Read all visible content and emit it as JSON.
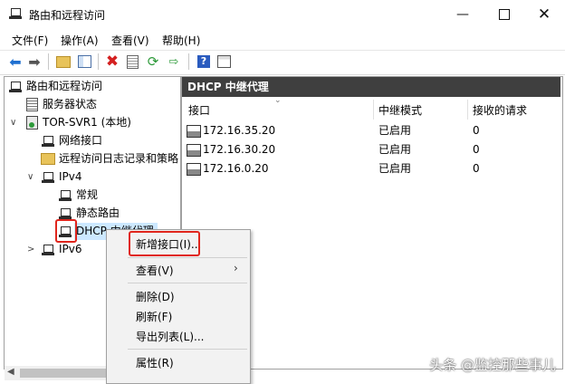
{
  "window": {
    "title": "路由和远程访问"
  },
  "menu": [
    "文件(F)",
    "操作(A)",
    "查看(V)",
    "帮助(H)"
  ],
  "tree": {
    "root": "路由和远程访问",
    "server_status": "服务器状态",
    "server": "TOR-SVR1 (本地)",
    "network_interfaces": "网络接口",
    "remote_logging": "远程访问日志记录和策略",
    "ipv4": "IPv4",
    "general": "常规",
    "static_routes": "静态路由",
    "dhcp_relay": "DHCP 中继代理",
    "ipv6": "IPv6"
  },
  "list": {
    "title": "DHCP 中继代理",
    "columns": [
      "接口",
      "中继模式",
      "接收的请求"
    ],
    "rows": [
      {
        "interface": "172.16.35.20",
        "mode": "已启用",
        "requests": "0"
      },
      {
        "interface": "172.16.30.20",
        "mode": "已启用",
        "requests": "0"
      },
      {
        "interface": "172.16.0.20",
        "mode": "已启用",
        "requests": "0"
      }
    ]
  },
  "context_menu": {
    "new_interface": "新增接口(I)...",
    "view": "查看(V)",
    "delete": "删除(D)",
    "refresh": "刷新(F)",
    "export": "导出列表(L)...",
    "properties": "属性(R)"
  },
  "watermark": "头条 @监控那些事儿",
  "colors": {
    "header_bg": "#3f3f3f",
    "highlight": "#e0261d",
    "selected_bg": "#cce8ff"
  }
}
